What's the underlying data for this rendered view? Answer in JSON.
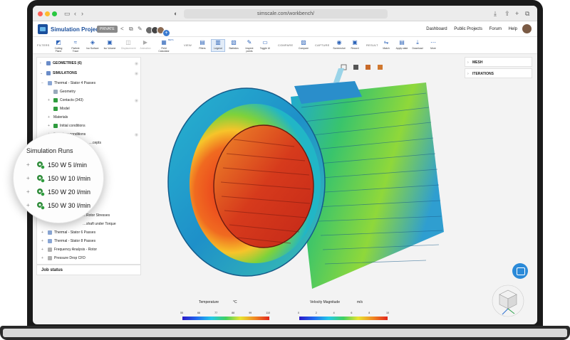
{
  "browser": {
    "url": "simscale.com/workbench/"
  },
  "app": {
    "project_title": "Simulation Project",
    "visibility_badge": "PRIVATE",
    "nav": [
      "Dashboard",
      "Public Projects",
      "Forum",
      "Help"
    ]
  },
  "toolbar": {
    "groups": [
      "FILTERS",
      "VIEW",
      "COMPARE",
      "CAPTURE",
      "RESULT"
    ],
    "filters": [
      "Cutting Plane",
      "Particle Trace",
      "Iso Surface",
      "Iso Volume",
      "Displacement",
      "Animation",
      "Field Calculator"
    ],
    "view": [
      "Filters",
      "Legend",
      "Statistics",
      "Inspect points",
      "Toggle UI"
    ],
    "compare": [
      "Compare"
    ],
    "capture": [
      "Screenshot",
      "Record"
    ],
    "result": [
      "Match",
      "Apply state",
      "Download",
      "More"
    ],
    "beta_badge": "BETA"
  },
  "tree": {
    "geometries": "GEOMETRIES (6)",
    "simulations": "SIMULATIONS",
    "items": [
      {
        "label": "Thermal - Stator 4 Passes",
        "indent": 1
      },
      {
        "label": "Geometry",
        "indent": 2
      },
      {
        "label": "Contacts (343)",
        "indent": 2
      },
      {
        "label": "Model",
        "indent": 2
      },
      {
        "label": "Materials",
        "indent": 2
      },
      {
        "label": "Initial conditions",
        "indent": 2
      },
      {
        "label": "Boundary conditions",
        "indent": 2
      },
      {
        "label": "…cepts",
        "indent": 2
      }
    ],
    "lower_items": [
      {
        "label": "…shaft under Torque"
      },
      {
        "label": "Thermal - Stator 6 Passes"
      },
      {
        "label": "Thermal - Stator 8 Passes"
      },
      {
        "label": "Frequency Analysis - Rotor"
      },
      {
        "label": "Pressure Drop CFD"
      }
    ],
    "partial_row": "…Rotor Stresses"
  },
  "job_status": "Job status",
  "panels": [
    "MESH",
    "ITERATIONS"
  ],
  "magnifier": {
    "title": "Simulation Runs",
    "runs": [
      "150 W 5 l/min",
      "150 W 10 l/min",
      "150 W 20 l/min",
      "150 W 30 l/min"
    ]
  },
  "legends": [
    {
      "label": "Temperature",
      "unit": "°C",
      "ticks": [
        "55",
        "66",
        "77",
        "88",
        "99",
        "110"
      ]
    },
    {
      "label": "Velocity Magnitude",
      "unit": "m/s",
      "ticks": [
        "0",
        "2",
        "4",
        "6",
        "8",
        "10"
      ]
    }
  ],
  "colors": {
    "brand": "#1b4f9c",
    "accent": "#2b8ad8",
    "check": "#2f9c3e"
  }
}
